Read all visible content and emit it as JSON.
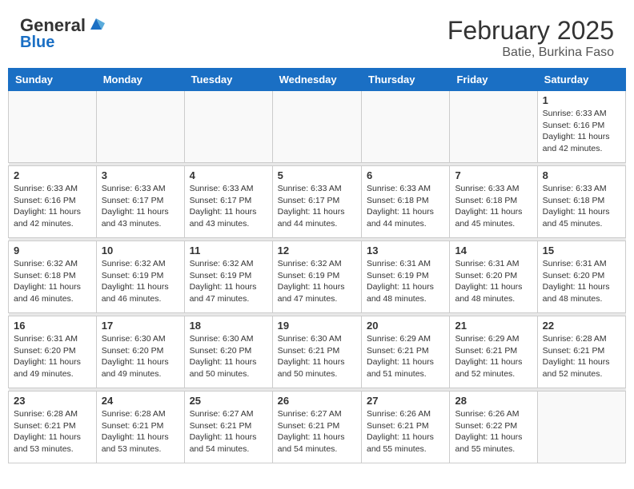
{
  "header": {
    "logo_line1": "General",
    "logo_line2": "Blue",
    "month": "February 2025",
    "location": "Batie, Burkina Faso"
  },
  "days_of_week": [
    "Sunday",
    "Monday",
    "Tuesday",
    "Wednesday",
    "Thursday",
    "Friday",
    "Saturday"
  ],
  "weeks": [
    [
      {
        "day": "",
        "info": ""
      },
      {
        "day": "",
        "info": ""
      },
      {
        "day": "",
        "info": ""
      },
      {
        "day": "",
        "info": ""
      },
      {
        "day": "",
        "info": ""
      },
      {
        "day": "",
        "info": ""
      },
      {
        "day": "1",
        "info": "Sunrise: 6:33 AM\nSunset: 6:16 PM\nDaylight: 11 hours and 42 minutes."
      }
    ],
    [
      {
        "day": "2",
        "info": "Sunrise: 6:33 AM\nSunset: 6:16 PM\nDaylight: 11 hours and 42 minutes."
      },
      {
        "day": "3",
        "info": "Sunrise: 6:33 AM\nSunset: 6:17 PM\nDaylight: 11 hours and 43 minutes."
      },
      {
        "day": "4",
        "info": "Sunrise: 6:33 AM\nSunset: 6:17 PM\nDaylight: 11 hours and 43 minutes."
      },
      {
        "day": "5",
        "info": "Sunrise: 6:33 AM\nSunset: 6:17 PM\nDaylight: 11 hours and 44 minutes."
      },
      {
        "day": "6",
        "info": "Sunrise: 6:33 AM\nSunset: 6:18 PM\nDaylight: 11 hours and 44 minutes."
      },
      {
        "day": "7",
        "info": "Sunrise: 6:33 AM\nSunset: 6:18 PM\nDaylight: 11 hours and 45 minutes."
      },
      {
        "day": "8",
        "info": "Sunrise: 6:33 AM\nSunset: 6:18 PM\nDaylight: 11 hours and 45 minutes."
      }
    ],
    [
      {
        "day": "9",
        "info": "Sunrise: 6:32 AM\nSunset: 6:18 PM\nDaylight: 11 hours and 46 minutes."
      },
      {
        "day": "10",
        "info": "Sunrise: 6:32 AM\nSunset: 6:19 PM\nDaylight: 11 hours and 46 minutes."
      },
      {
        "day": "11",
        "info": "Sunrise: 6:32 AM\nSunset: 6:19 PM\nDaylight: 11 hours and 47 minutes."
      },
      {
        "day": "12",
        "info": "Sunrise: 6:32 AM\nSunset: 6:19 PM\nDaylight: 11 hours and 47 minutes."
      },
      {
        "day": "13",
        "info": "Sunrise: 6:31 AM\nSunset: 6:19 PM\nDaylight: 11 hours and 48 minutes."
      },
      {
        "day": "14",
        "info": "Sunrise: 6:31 AM\nSunset: 6:20 PM\nDaylight: 11 hours and 48 minutes."
      },
      {
        "day": "15",
        "info": "Sunrise: 6:31 AM\nSunset: 6:20 PM\nDaylight: 11 hours and 48 minutes."
      }
    ],
    [
      {
        "day": "16",
        "info": "Sunrise: 6:31 AM\nSunset: 6:20 PM\nDaylight: 11 hours and 49 minutes."
      },
      {
        "day": "17",
        "info": "Sunrise: 6:30 AM\nSunset: 6:20 PM\nDaylight: 11 hours and 49 minutes."
      },
      {
        "day": "18",
        "info": "Sunrise: 6:30 AM\nSunset: 6:20 PM\nDaylight: 11 hours and 50 minutes."
      },
      {
        "day": "19",
        "info": "Sunrise: 6:30 AM\nSunset: 6:21 PM\nDaylight: 11 hours and 50 minutes."
      },
      {
        "day": "20",
        "info": "Sunrise: 6:29 AM\nSunset: 6:21 PM\nDaylight: 11 hours and 51 minutes."
      },
      {
        "day": "21",
        "info": "Sunrise: 6:29 AM\nSunset: 6:21 PM\nDaylight: 11 hours and 52 minutes."
      },
      {
        "day": "22",
        "info": "Sunrise: 6:28 AM\nSunset: 6:21 PM\nDaylight: 11 hours and 52 minutes."
      }
    ],
    [
      {
        "day": "23",
        "info": "Sunrise: 6:28 AM\nSunset: 6:21 PM\nDaylight: 11 hours and 53 minutes."
      },
      {
        "day": "24",
        "info": "Sunrise: 6:28 AM\nSunset: 6:21 PM\nDaylight: 11 hours and 53 minutes."
      },
      {
        "day": "25",
        "info": "Sunrise: 6:27 AM\nSunset: 6:21 PM\nDaylight: 11 hours and 54 minutes."
      },
      {
        "day": "26",
        "info": "Sunrise: 6:27 AM\nSunset: 6:21 PM\nDaylight: 11 hours and 54 minutes."
      },
      {
        "day": "27",
        "info": "Sunrise: 6:26 AM\nSunset: 6:21 PM\nDaylight: 11 hours and 55 minutes."
      },
      {
        "day": "28",
        "info": "Sunrise: 6:26 AM\nSunset: 6:22 PM\nDaylight: 11 hours and 55 minutes."
      },
      {
        "day": "",
        "info": ""
      }
    ]
  ]
}
